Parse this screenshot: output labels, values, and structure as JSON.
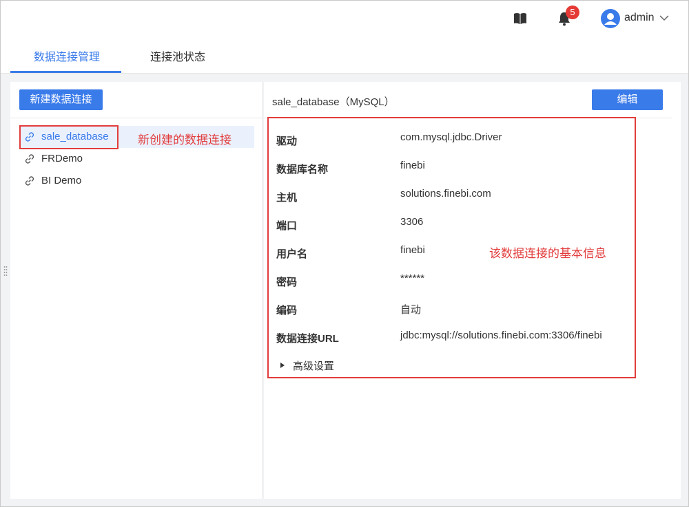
{
  "header": {
    "badge_count": "5",
    "username": "admin",
    "icons": [
      "book-icon",
      "bell-icon",
      "user-avatar-icon",
      "chevron-down-icon"
    ]
  },
  "tabs": [
    {
      "label": "数据连接管理",
      "active": true
    },
    {
      "label": "连接池状态",
      "active": false
    }
  ],
  "left": {
    "new_button": "新建数据连接",
    "connections": [
      {
        "label": "sale_database",
        "selected": true
      },
      {
        "label": "FRDemo",
        "selected": false
      },
      {
        "label": "BI Demo",
        "selected": false
      }
    ]
  },
  "annotations": {
    "new_connection": "新创建的数据连接",
    "basic_info": "该数据连接的基本信息"
  },
  "detail": {
    "title": "sale_database（MySQL）",
    "edit_button": "编辑",
    "fields": [
      {
        "label": "驱动",
        "value": "com.mysql.jdbc.Driver"
      },
      {
        "label": "数据库名称",
        "value": "finebi"
      },
      {
        "label": "主机",
        "value": "solutions.finebi.com"
      },
      {
        "label": "端口",
        "value": "3306"
      },
      {
        "label": "用户名",
        "value": "finebi"
      },
      {
        "label": "密码",
        "value": "******"
      },
      {
        "label": "编码",
        "value": "自动"
      },
      {
        "label": "数据连接URL",
        "value": "jdbc:mysql://solutions.finebi.com:3306/finebi"
      }
    ],
    "advanced": "高级设置"
  },
  "colors": {
    "accent": "#3a7bea",
    "annotation": "#e23b3b",
    "badge": "#e53935"
  }
}
